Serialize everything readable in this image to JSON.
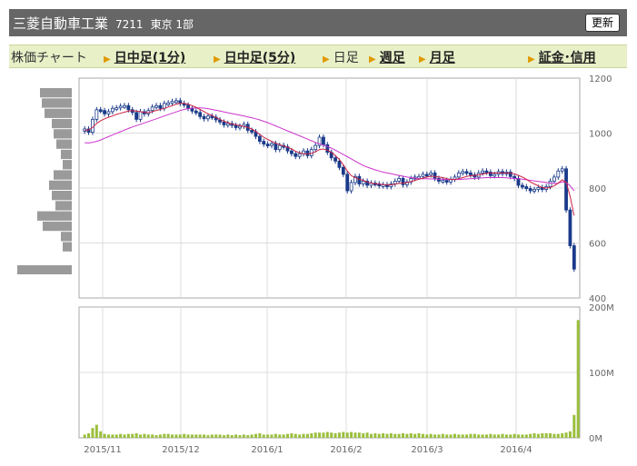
{
  "header": {
    "company": "三菱自動車工業",
    "code": "7211",
    "market": "東京 1部",
    "refresh_label": "更新"
  },
  "tabs": [
    {
      "label": "株価チャート",
      "style": "first"
    },
    {
      "label": "日中足(1分)",
      "style": "link"
    },
    {
      "label": "日中足(5分)",
      "style": "link"
    },
    {
      "label": "日足",
      "style": "plain"
    },
    {
      "label": "週足",
      "style": "link"
    },
    {
      "label": "月足",
      "style": "link"
    },
    {
      "label": "証金･信用",
      "style": "link"
    }
  ],
  "colors": {
    "header_bg": "#666666",
    "tab_bg": "#e8f0c8",
    "candle_up": "#ffffff",
    "candle_down": "#1a3a8a",
    "ma_short": "#cc2244",
    "ma_long": "#cc33cc",
    "volume": "#9abf3c",
    "volume_profile": "#9a9a9a"
  },
  "chart_data": {
    "type": "candlestick",
    "price_axis": {
      "ticks": [
        "1200",
        "1000",
        "800",
        "600",
        "400"
      ],
      "ylim": [
        400,
        1200
      ]
    },
    "volume_axis": {
      "ticks": [
        "200M",
        "100M",
        "0M"
      ],
      "ylim": [
        0,
        200
      ]
    },
    "x_ticks": [
      "2015/11",
      "2015/12",
      "2016/1",
      "2016/2",
      "2016/3",
      "2016/4"
    ],
    "close": [
      1015,
      1003,
      1050,
      1085,
      1082,
      1070,
      1078,
      1090,
      1092,
      1098,
      1100,
      1085,
      1075,
      1050,
      1078,
      1070,
      1082,
      1095,
      1100,
      1090,
      1108,
      1110,
      1115,
      1118,
      1108,
      1102,
      1090,
      1080,
      1075,
      1060,
      1052,
      1062,
      1058,
      1048,
      1040,
      1030,
      1035,
      1028,
      1020,
      1025,
      1032,
      1010,
      1005,
      988,
      970,
      960,
      955,
      962,
      940,
      955,
      950,
      935,
      925,
      915,
      925,
      935,
      918,
      940,
      955,
      985,
      958,
      930,
      910,
      898,
      875,
      850,
      790,
      820,
      842,
      815,
      825,
      810,
      818,
      815,
      808,
      812,
      805,
      815,
      825,
      835,
      812,
      822,
      835,
      840,
      842,
      850,
      848,
      855,
      835,
      825,
      828,
      822,
      832,
      840,
      855,
      860,
      855,
      848,
      840,
      855,
      862,
      858,
      845,
      850,
      860,
      852,
      858,
      842,
      835,
      810,
      805,
      798,
      790,
      795,
      802,
      795,
      805,
      825,
      840,
      862,
      870,
      720,
      590,
      505
    ],
    "ma_short": [
      1010,
      1012,
      1020,
      1035,
      1045,
      1052,
      1058,
      1062,
      1068,
      1072,
      1076,
      1080,
      1082,
      1080,
      1078,
      1075,
      1074,
      1078,
      1082,
      1086,
      1090,
      1095,
      1100,
      1105,
      1108,
      1108,
      1105,
      1100,
      1094,
      1086,
      1078,
      1070,
      1064,
      1057,
      1050,
      1043,
      1038,
      1033,
      1030,
      1027,
      1024,
      1020,
      1015,
      1006,
      995,
      985,
      977,
      970,
      963,
      958,
      953,
      948,
      942,
      934,
      928,
      925,
      924,
      926,
      932,
      940,
      942,
      938,
      930,
      918,
      904,
      885,
      862,
      845,
      838,
      832,
      828,
      822,
      818,
      816,
      814,
      813,
      812,
      812,
      814,
      817,
      818,
      820,
      823,
      828,
      832,
      836,
      840,
      843,
      842,
      840,
      838,
      834,
      831,
      831,
      834,
      838,
      842,
      845,
      846,
      848,
      851,
      854,
      855,
      855,
      855,
      855,
      855,
      854,
      852,
      846,
      840,
      832,
      822,
      815,
      808,
      802,
      800,
      802,
      808,
      818,
      830,
      820,
      770,
      700
    ],
    "ma_long": [
      965,
      964,
      966,
      970,
      975,
      981,
      987,
      993,
      999,
      1005,
      1011,
      1017,
      1022,
      1027,
      1032,
      1037,
      1042,
      1047,
      1052,
      1057,
      1062,
      1067,
      1072,
      1077,
      1082,
      1086,
      1089,
      1091,
      1092,
      1092,
      1091,
      1089,
      1086,
      1083,
      1080,
      1077,
      1074,
      1071,
      1068,
      1065,
      1062,
      1059,
      1056,
      1052,
      1048,
      1043,
      1038,
      1032,
      1026,
      1020,
      1014,
      1008,
      1002,
      996,
      990,
      984,
      978,
      972,
      966,
      961,
      956,
      951,
      945,
      938,
      930,
      922,
      914,
      906,
      898,
      890,
      882,
      876,
      871,
      866,
      862,
      858,
      855,
      852,
      849,
      846,
      843,
      840,
      838,
      836,
      835,
      834,
      834,
      833,
      833,
      832,
      832,
      831,
      831,
      831,
      831,
      832,
      833,
      834,
      835,
      836,
      837,
      838,
      838,
      838,
      838,
      838,
      837,
      836,
      835,
      834,
      832,
      830,
      828,
      826,
      824,
      822,
      820,
      818,
      817,
      818,
      822,
      820,
      808,
      790
    ],
    "volume": [
      5,
      7,
      15,
      20,
      10,
      6,
      5,
      5,
      5,
      6,
      5,
      6,
      6,
      7,
      5,
      6,
      5,
      5,
      4,
      5,
      6,
      6,
      5,
      5,
      5,
      6,
      5,
      5,
      5,
      5,
      5,
      4,
      5,
      5,
      5,
      4,
      5,
      4,
      5,
      4,
      5,
      4,
      5,
      6,
      7,
      5,
      5,
      5,
      6,
      5,
      5,
      6,
      7,
      6,
      5,
      6,
      6,
      7,
      8,
      8,
      8,
      9,
      8,
      7,
      8,
      9,
      8,
      9,
      8,
      8,
      7,
      8,
      6,
      7,
      6,
      7,
      6,
      7,
      6,
      6,
      7,
      6,
      7,
      6,
      7,
      6,
      5,
      6,
      5,
      5,
      6,
      5,
      5,
      6,
      5,
      5,
      5,
      6,
      6,
      5,
      5,
      5,
      6,
      5,
      5,
      6,
      5,
      5,
      6,
      5,
      5,
      5,
      6,
      7,
      6,
      7,
      7,
      7,
      6,
      6,
      7,
      8,
      10,
      35,
      180
    ],
    "volume_profile": [
      35,
      33,
      30,
      22,
      20,
      17,
      12,
      10,
      20,
      25,
      22,
      18,
      38,
      32,
      12,
      10,
      2,
      60
    ]
  }
}
